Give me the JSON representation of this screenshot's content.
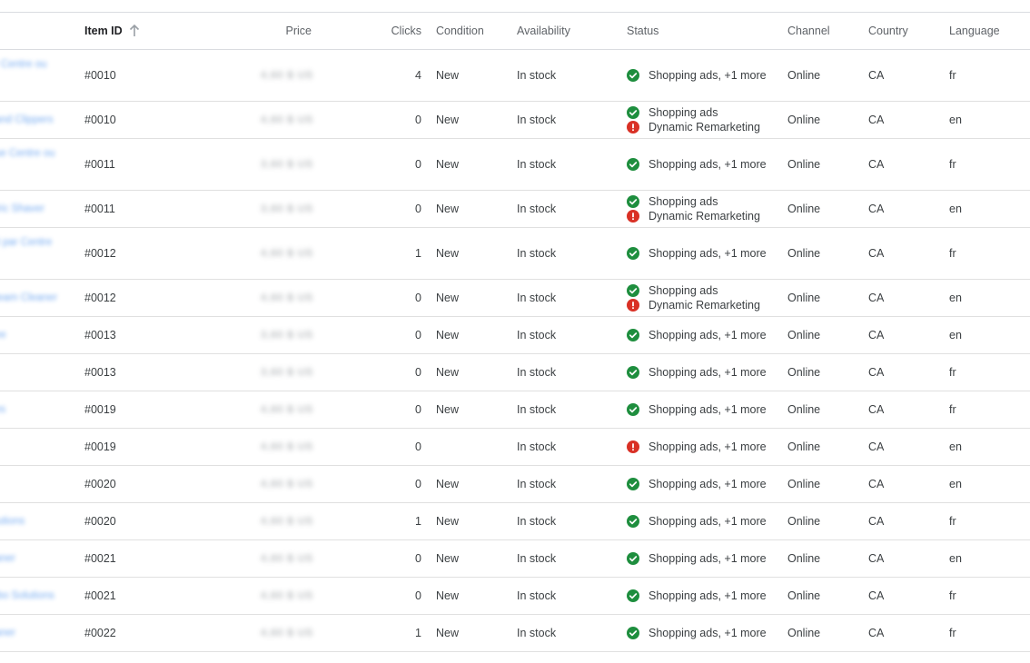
{
  "columns": {
    "item_id": "Item ID",
    "price": "Price",
    "clicks": "Clicks",
    "condition": "Condition",
    "availability": "Availability",
    "status": "Status",
    "channel": "Channel",
    "country": "Country",
    "language": "Language"
  },
  "icons": {
    "sort": "arrow-up-icon",
    "ok": "check-circle-icon",
    "error": "error-circle-icon"
  },
  "colors": {
    "ok": "#1e8e3e",
    "error": "#d93025",
    "link": "#1a73e8"
  },
  "rows": [
    {
      "title": "r Centre ou",
      "id": "#0010",
      "price": "4,60 $ US",
      "clicks": "4",
      "condition": "New",
      "availability": "In stock",
      "status": [
        {
          "icon": "ok",
          "text": "Shopping ads, +1 more"
        }
      ],
      "channel": "Online",
      "country": "CA",
      "language": "fr"
    },
    {
      "title": "and Clippers",
      "id": "#0010",
      "price": "4,60 $ US",
      "clicks": "0",
      "condition": "New",
      "availability": "In stock",
      "status": [
        {
          "icon": "ok",
          "text": "Shopping ads"
        },
        {
          "icon": "error",
          "text": "Dynamic Remarketing"
        }
      ],
      "channel": "Online",
      "country": "CA",
      "language": "en"
    },
    {
      "title": "ue Centre ou",
      "id": "#0011",
      "price": "3,60 $ US",
      "clicks": "0",
      "condition": "New",
      "availability": "In stock",
      "status": [
        {
          "icon": "ok",
          "text": "Shopping ads, +1 more"
        }
      ],
      "channel": "Online",
      "country": "CA",
      "language": "fr"
    },
    {
      "title": "tric Shaver",
      "id": "#0011",
      "price": "3,60 $ US",
      "clicks": "0",
      "condition": "New",
      "availability": "In stock",
      "status": [
        {
          "icon": "ok",
          "text": "Shopping ads"
        },
        {
          "icon": "error",
          "text": "Dynamic Remarketing"
        }
      ],
      "channel": "Online",
      "country": "CA",
      "language": "en"
    },
    {
      "title": "it par Centre",
      "id": "#0012",
      "price": "4,60 $ US",
      "clicks": "1",
      "condition": "New",
      "availability": "In stock",
      "status": [
        {
          "icon": "ok",
          "text": "Shopping ads, +1 more"
        }
      ],
      "channel": "Online",
      "country": "CA",
      "language": "fr"
    },
    {
      "title": "team Cleaner",
      "id": "#0012",
      "price": "4,60 $ US",
      "clicks": "0",
      "condition": "New",
      "availability": "In stock",
      "status": [
        {
          "icon": "ok",
          "text": "Shopping ads"
        },
        {
          "icon": "error",
          "text": "Dynamic Remarketing"
        }
      ],
      "channel": "Online",
      "country": "CA",
      "language": "en"
    },
    {
      "title": "ee",
      "id": "#0013",
      "price": "3,60 $ US",
      "clicks": "0",
      "condition": "New",
      "availability": "In stock",
      "status": [
        {
          "icon": "ok",
          "text": "Shopping ads, +1 more"
        }
      ],
      "channel": "Online",
      "country": "CA",
      "language": "en"
    },
    {
      "title": "",
      "id": "#0013",
      "price": "3,60 $ US",
      "clicks": "0",
      "condition": "New",
      "availability": "In stock",
      "status": [
        {
          "icon": "ok",
          "text": "Shopping ads, +1 more"
        }
      ],
      "channel": "Online",
      "country": "CA",
      "language": "fr"
    },
    {
      "title": "es",
      "id": "#0019",
      "price": "4,60 $ US",
      "clicks": "0",
      "condition": "New",
      "availability": "In stock",
      "status": [
        {
          "icon": "ok",
          "text": "Shopping ads, +1 more"
        }
      ],
      "channel": "Online",
      "country": "CA",
      "language": "fr"
    },
    {
      "title": "",
      "id": "#0019",
      "price": "4,60 $ US",
      "clicks": "0",
      "condition": "",
      "availability": "In stock",
      "status": [
        {
          "icon": "error",
          "text": "Shopping ads, +1 more"
        }
      ],
      "channel": "Online",
      "country": "CA",
      "language": "en"
    },
    {
      "title": "",
      "id": "#0020",
      "price": "4,60 $ US",
      "clicks": "0",
      "condition": "New",
      "availability": "In stock",
      "status": [
        {
          "icon": "ok",
          "text": "Shopping ads, +1 more"
        }
      ],
      "channel": "Online",
      "country": "CA",
      "language": "en"
    },
    {
      "title": "lutions",
      "id": "#0020",
      "price": "4,60 $ US",
      "clicks": "1",
      "condition": "New",
      "availability": "In stock",
      "status": [
        {
          "icon": "ok",
          "text": "Shopping ads, +1 more"
        }
      ],
      "channel": "Online",
      "country": "CA",
      "language": "fr"
    },
    {
      "title": "aner",
      "id": "#0021",
      "price": "4,60 $ US",
      "clicks": "0",
      "condition": "New",
      "availability": "In stock",
      "status": [
        {
          "icon": "ok",
          "text": "Shopping ads, +1 more"
        }
      ],
      "channel": "Online",
      "country": "CA",
      "language": "en"
    },
    {
      "title": "ibo Solutions",
      "id": "#0021",
      "price": "4,60 $ US",
      "clicks": "0",
      "condition": "New",
      "availability": "In stock",
      "status": [
        {
          "icon": "ok",
          "text": "Shopping ads, +1 more"
        }
      ],
      "channel": "Online",
      "country": "CA",
      "language": "fr"
    },
    {
      "title": "aner",
      "id": "#0022",
      "price": "4,60 $ US",
      "clicks": "1",
      "condition": "New",
      "availability": "In stock",
      "status": [
        {
          "icon": "ok",
          "text": "Shopping ads, +1 more"
        }
      ],
      "channel": "Online",
      "country": "CA",
      "language": "fr"
    }
  ]
}
